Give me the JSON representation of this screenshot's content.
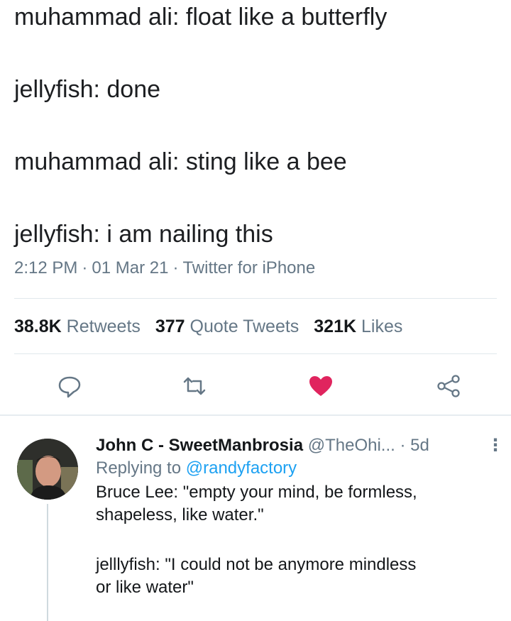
{
  "tweet": {
    "lines": [
      "muhammad ali: float like a butterfly",
      "jellyfish: done",
      "muhammad ali: sting like a bee",
      "jellyfish: i am nailing this"
    ],
    "time": "2:12 PM",
    "date": "01 Mar 21",
    "source": "Twitter for iPhone"
  },
  "stats": {
    "retweets_count": "38.8K",
    "retweets_label": "Retweets",
    "quotes_count": "377",
    "quotes_label": "Quote Tweets",
    "likes_count": "321K",
    "likes_label": "Likes"
  },
  "actions": {
    "icons": [
      "reply-icon",
      "retweet-icon",
      "heart-icon",
      "share-icon"
    ],
    "like_color": "#e0245e"
  },
  "reply": {
    "name": "John C - SweetManbrosia",
    "handle": "@TheOhi...",
    "time": "5d",
    "replying_label": "Replying to",
    "replying_handle": "@randyfactory",
    "body_lines": [
      "Bruce Lee: \"empty your mind, be formless,",
      "shapeless, like water.\"",
      "jelllyfish: \"I could not  be anymore mindless",
      "or like water\""
    ]
  }
}
